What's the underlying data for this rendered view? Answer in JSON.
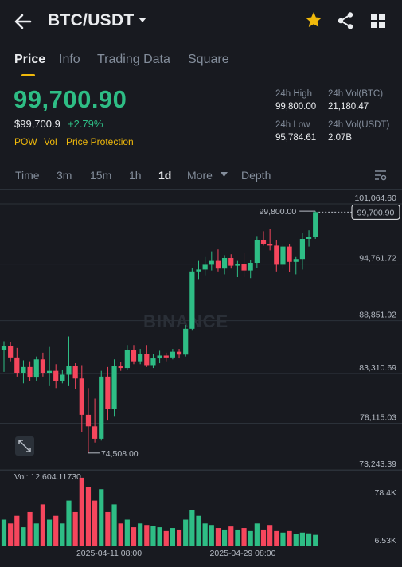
{
  "header": {
    "pair": "BTC/USDT",
    "icons": [
      "back-arrow-icon",
      "chevron-down-icon",
      "star-icon",
      "share-icon",
      "grid-icon"
    ],
    "star_color": "#f0b90b"
  },
  "tabs": [
    {
      "label": "Price",
      "active": true
    },
    {
      "label": "Info",
      "active": false
    },
    {
      "label": "Trading Data",
      "active": false
    },
    {
      "label": "Square",
      "active": false
    }
  ],
  "price": {
    "last": "99,700.90",
    "usd": "$99,700.9",
    "change": "+2.79%",
    "tags": [
      "POW",
      "Vol",
      "Price Protection"
    ]
  },
  "stats": {
    "high_label": "24h High",
    "high": "99,800.00",
    "low_label": "24h Low",
    "low": "95,784.61",
    "vol_btc_label": "24h Vol(BTC)",
    "vol_btc": "21,180.47",
    "vol_usdt_label": "24h Vol(USDT)",
    "vol_usdt": "2.07B"
  },
  "intervals": {
    "items": [
      "Time",
      "3m",
      "15m",
      "1h",
      "1d",
      "More",
      "Depth"
    ],
    "active": "1d"
  },
  "colors": {
    "up": "#2ebd85",
    "down": "#f6465d",
    "bg": "#181a20",
    "accent": "#f0b90b"
  },
  "chart": {
    "watermark": "BINANCE",
    "last_price_label": "99,700.90",
    "high_marker": "99,800.00",
    "low_marker": "74,508.00",
    "vol_label": "Vol: 12,604.11730",
    "vol_max": "78.4K",
    "vol_min": "6.53K"
  },
  "chart_data": {
    "type": "candlestick",
    "yticks": [
      "101,064.60",
      "94,761.72",
      "88,851.92",
      "83,310.69",
      "78,115.03",
      "73,243.39"
    ],
    "xticks": [
      "2025-04-11 08:00",
      "2025-04-29 08:00"
    ],
    "candles": [
      {
        "o": 85300,
        "h": 86200,
        "l": 83000,
        "c": 85700
      },
      {
        "o": 85700,
        "h": 86100,
        "l": 84100,
        "c": 84500
      },
      {
        "o": 84500,
        "h": 85500,
        "l": 82500,
        "c": 82900
      },
      {
        "o": 82900,
        "h": 84200,
        "l": 81800,
        "c": 83500
      },
      {
        "o": 83500,
        "h": 84100,
        "l": 82000,
        "c": 82400
      },
      {
        "o": 82400,
        "h": 84600,
        "l": 82000,
        "c": 84300
      },
      {
        "o": 84300,
        "h": 85000,
        "l": 82500,
        "c": 82900
      },
      {
        "o": 82900,
        "h": 85600,
        "l": 81500,
        "c": 83100
      },
      {
        "o": 83100,
        "h": 83800,
        "l": 81300,
        "c": 82000
      },
      {
        "o": 82000,
        "h": 83200,
        "l": 81800,
        "c": 82700
      },
      {
        "o": 82700,
        "h": 86700,
        "l": 81500,
        "c": 83600
      },
      {
        "o": 83600,
        "h": 83900,
        "l": 81200,
        "c": 82300
      },
      {
        "o": 82300,
        "h": 83700,
        "l": 76700,
        "c": 78500
      },
      {
        "o": 78500,
        "h": 81300,
        "l": 74508,
        "c": 77300
      },
      {
        "o": 77300,
        "h": 80200,
        "l": 75600,
        "c": 76000
      },
      {
        "o": 76000,
        "h": 83100,
        "l": 75800,
        "c": 82500
      },
      {
        "o": 82500,
        "h": 83500,
        "l": 77900,
        "c": 79100
      },
      {
        "o": 79100,
        "h": 84300,
        "l": 78300,
        "c": 83600
      },
      {
        "o": 83600,
        "h": 84000,
        "l": 83100,
        "c": 83400
      },
      {
        "o": 83400,
        "h": 85800,
        "l": 83200,
        "c": 85300
      },
      {
        "o": 85300,
        "h": 85800,
        "l": 83800,
        "c": 84100
      },
      {
        "o": 84100,
        "h": 85400,
        "l": 83800,
        "c": 84900
      },
      {
        "o": 84900,
        "h": 85800,
        "l": 83500,
        "c": 83700
      },
      {
        "o": 83700,
        "h": 84900,
        "l": 83400,
        "c": 84400
      },
      {
        "o": 84400,
        "h": 85200,
        "l": 83900,
        "c": 84700
      },
      {
        "o": 84700,
        "h": 85000,
        "l": 84100,
        "c": 84500
      },
      {
        "o": 84500,
        "h": 85400,
        "l": 84300,
        "c": 85100
      },
      {
        "o": 85100,
        "h": 85400,
        "l": 84400,
        "c": 84800
      },
      {
        "o": 84800,
        "h": 87900,
        "l": 84600,
        "c": 87500
      },
      {
        "o": 87500,
        "h": 93900,
        "l": 87300,
        "c": 93500
      },
      {
        "o": 93500,
        "h": 94600,
        "l": 92700,
        "c": 93700
      },
      {
        "o": 93700,
        "h": 95000,
        "l": 93100,
        "c": 94200
      },
      {
        "o": 94200,
        "h": 95600,
        "l": 93600,
        "c": 94600
      },
      {
        "o": 94600,
        "h": 95800,
        "l": 93500,
        "c": 93800
      },
      {
        "o": 93800,
        "h": 95200,
        "l": 93200,
        "c": 94900
      },
      {
        "o": 94900,
        "h": 95300,
        "l": 93800,
        "c": 94100
      },
      {
        "o": 94100,
        "h": 94600,
        "l": 92900,
        "c": 94300
      },
      {
        "o": 94300,
        "h": 95400,
        "l": 92900,
        "c": 93600
      },
      {
        "o": 93600,
        "h": 94700,
        "l": 92800,
        "c": 94400
      },
      {
        "o": 94400,
        "h": 97200,
        "l": 93900,
        "c": 96800
      },
      {
        "o": 96800,
        "h": 97700,
        "l": 96200,
        "c": 96400
      },
      {
        "o": 96400,
        "h": 97900,
        "l": 95700,
        "c": 96200
      },
      {
        "o": 96200,
        "h": 96800,
        "l": 93500,
        "c": 94200
      },
      {
        "o": 94200,
        "h": 96400,
        "l": 93800,
        "c": 96100
      },
      {
        "o": 96100,
        "h": 96400,
        "l": 93400,
        "c": 94500
      },
      {
        "o": 94500,
        "h": 95000,
        "l": 93200,
        "c": 94800
      },
      {
        "o": 94800,
        "h": 97500,
        "l": 93700,
        "c": 96900
      },
      {
        "o": 96900,
        "h": 97800,
        "l": 96100,
        "c": 97100
      },
      {
        "o": 97100,
        "h": 99800,
        "l": 96900,
        "c": 99700.9
      }
    ],
    "volumes": [
      35,
      30,
      40,
      25,
      45,
      30,
      55,
      35,
      40,
      30,
      60,
      45,
      90,
      78.4,
      60,
      75,
      45,
      55,
      30,
      35,
      25,
      30,
      28,
      27,
      25,
      20,
      24,
      22,
      35,
      48,
      40,
      30,
      28,
      24,
      22,
      26,
      22,
      24,
      20,
      30,
      22,
      28,
      20,
      18,
      20,
      16,
      18,
      17,
      15
    ]
  }
}
